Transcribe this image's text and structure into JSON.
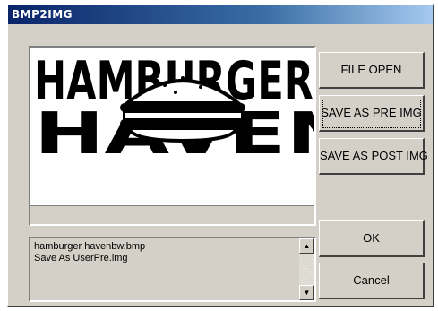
{
  "window": {
    "title": "BMP2IMG"
  },
  "preview": {
    "image_alt": "HAMBURGER HAVEN"
  },
  "buttons": {
    "file_open": "FILE OPEN",
    "save_as_pre": "SAVE AS PRE IMG",
    "save_as_post": "SAVE AS POST IMG",
    "ok": "OK",
    "cancel": "Cancel"
  },
  "log": {
    "lines": [
      "hamburger havenbw.bmp",
      "Save As UserPre.img"
    ]
  },
  "icons": {
    "scroll_up": "scroll-up-arrow-icon",
    "scroll_down": "scroll-down-arrow-icon"
  },
  "colors": {
    "title_start": "#0a246a",
    "title_end": "#a6caf0",
    "face": "#d4d0c8"
  }
}
